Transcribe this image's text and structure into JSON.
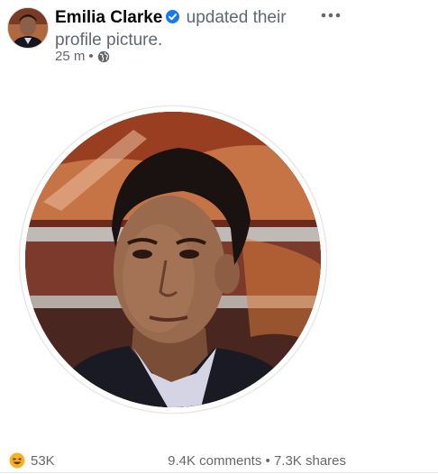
{
  "post": {
    "author": "Emilia Clarke",
    "action_text": "updated their profile picture.",
    "time": "25 m",
    "separator": "•",
    "audience_icon": "globe-icon",
    "more_icon": "more-horizontal-icon"
  },
  "profile_picture": {
    "alt": "profile picture"
  },
  "footer": {
    "reaction_icon": "haha-reaction-icon",
    "reaction_count": "53K",
    "comments": "9.4K comments",
    "shares_separator": "•",
    "shares": "7.3K shares"
  },
  "colors": {
    "verified": "#1877f2",
    "secondary_text": "#65676b",
    "primary_text": "#050505"
  }
}
